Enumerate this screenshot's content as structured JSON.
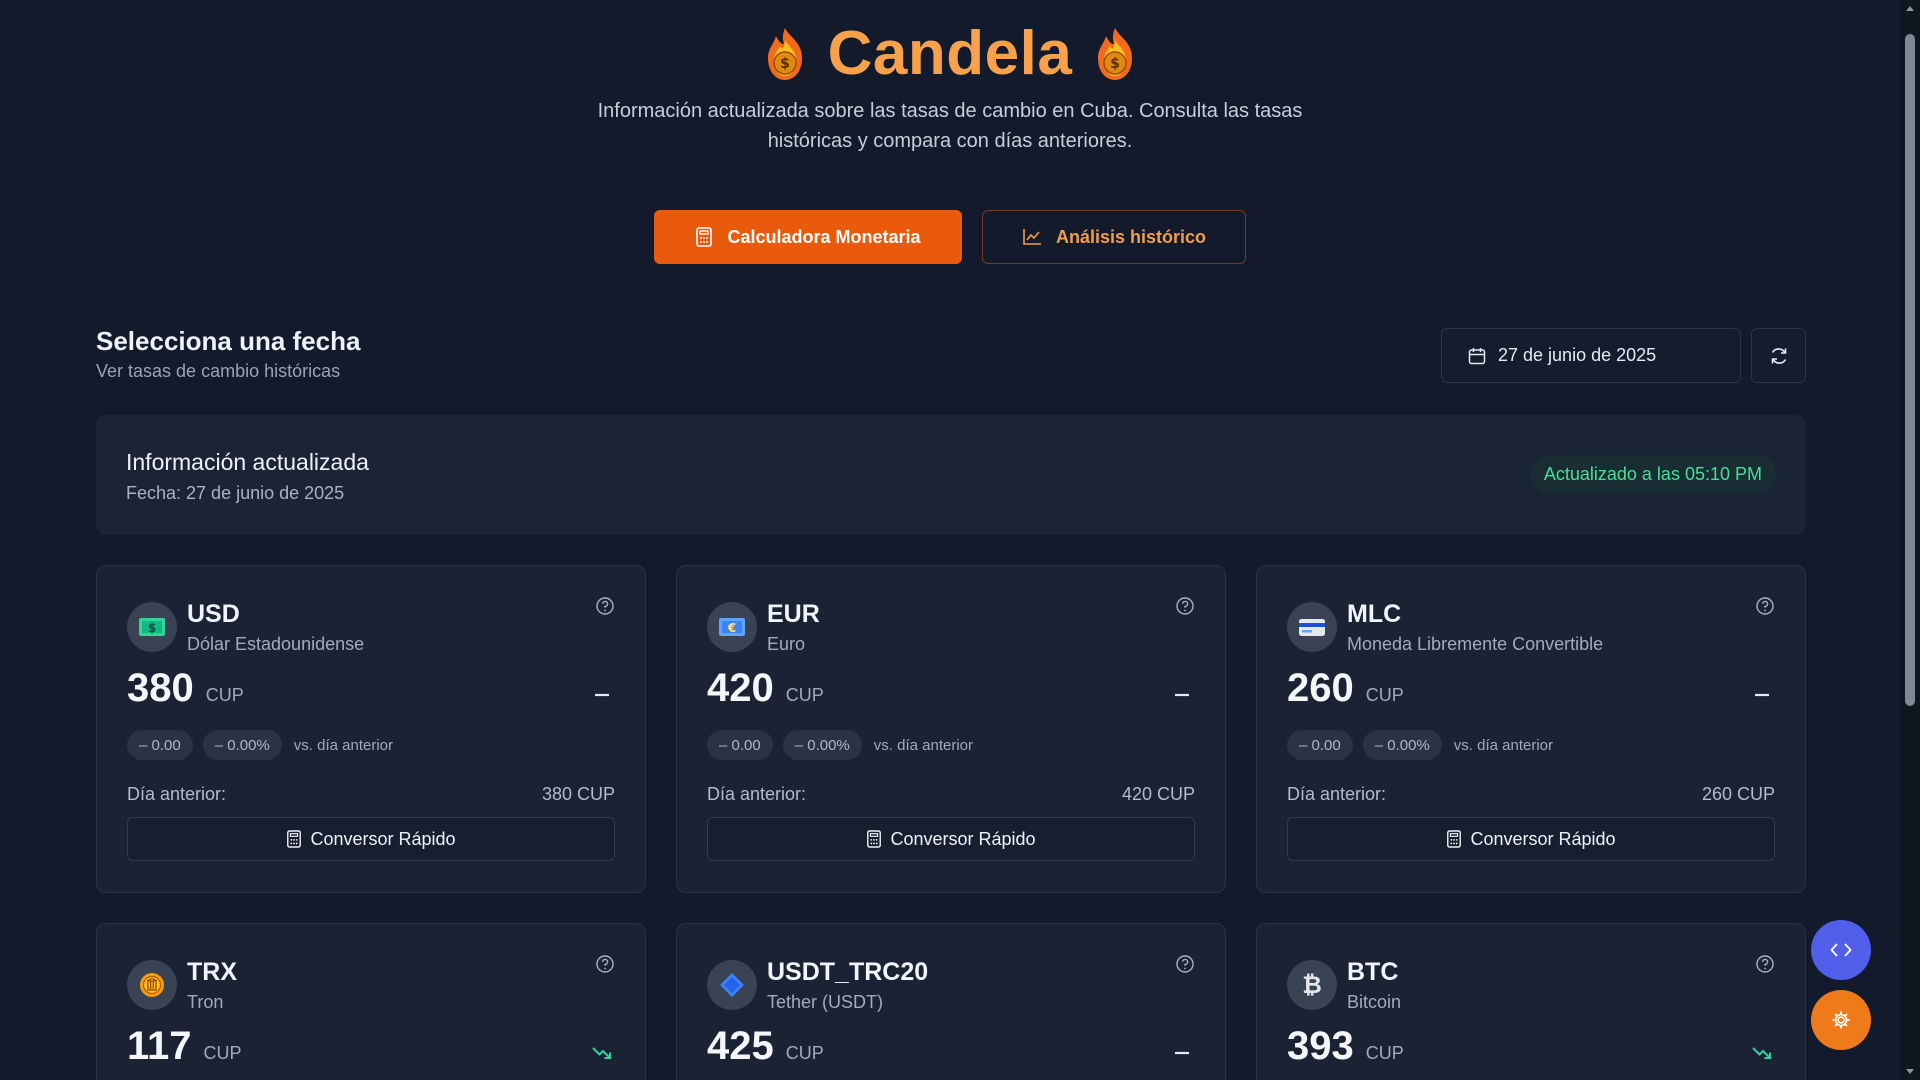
{
  "header": {
    "title": "Candela",
    "subtitle": "Información actualizada sobre las tasas de cambio en Cuba. Consulta las tasas históricas y compara con días anteriores."
  },
  "actions": {
    "calculator_label": "Calculadora Monetaria",
    "history_label": "Análisis histórico"
  },
  "date_section": {
    "title": "Selecciona una fecha",
    "subtitle": "Ver tasas de cambio históricas",
    "selected_date": "27 de junio de 2025"
  },
  "info": {
    "title": "Información actualizada",
    "date": "Fecha: 27 de junio de 2025",
    "updated": "Actualizado a las 05:10 PM"
  },
  "colors": {
    "accent": "#ea5a0c",
    "title": "#f7a24a",
    "success": "#4ade9a",
    "background": "#121a2b"
  },
  "cards": [
    {
      "code": "USD",
      "name": "Dólar Estadounidense",
      "rate": "380",
      "unit": "CUP",
      "trend": "flat",
      "change": "0.00",
      "change_pct": "0.00%",
      "vs": "vs. día anterior",
      "prev_label": "Día anterior:",
      "prev_value": "380 CUP",
      "convert_label": "Conversor Rápido",
      "icon": "dollar-bill-icon"
    },
    {
      "code": "EUR",
      "name": "Euro",
      "rate": "420",
      "unit": "CUP",
      "trend": "flat",
      "change": "0.00",
      "change_pct": "0.00%",
      "vs": "vs. día anterior",
      "prev_label": "Día anterior:",
      "prev_value": "420 CUP",
      "convert_label": "Conversor Rápido",
      "icon": "euro-bill-icon"
    },
    {
      "code": "MLC",
      "name": "Moneda Libremente Convertible",
      "rate": "260",
      "unit": "CUP",
      "trend": "flat",
      "change": "0.00",
      "change_pct": "0.00%",
      "vs": "vs. día anterior",
      "prev_label": "Día anterior:",
      "prev_value": "260 CUP",
      "convert_label": "Conversor Rápido",
      "icon": "credit-card-icon"
    },
    {
      "code": "TRX",
      "name": "Tron",
      "rate": "117",
      "unit": "CUP",
      "trend": "down",
      "icon": "tron-coin-icon"
    },
    {
      "code": "USDT_TRC20",
      "name": "Tether (USDT)",
      "rate": "425",
      "unit": "CUP",
      "trend": "flat",
      "icon": "tether-diamond-icon"
    },
    {
      "code": "BTC",
      "name": "Bitcoin",
      "rate": "393",
      "unit": "CUP",
      "trend": "down",
      "icon": "bitcoin-icon"
    }
  ]
}
